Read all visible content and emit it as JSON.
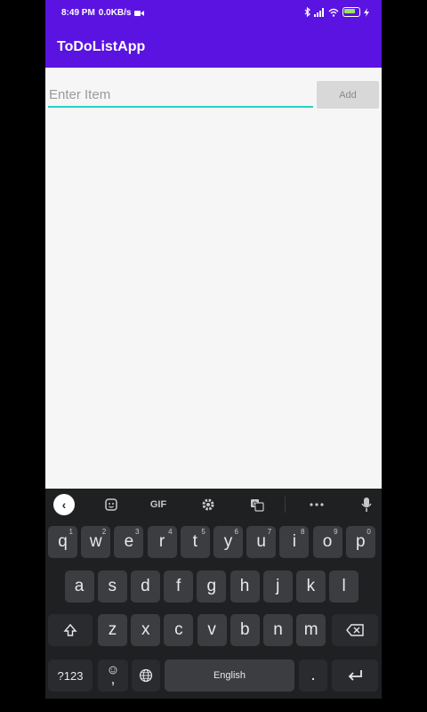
{
  "status": {
    "time": "8:49 PM",
    "net_speed": "0.0KB/s"
  },
  "app": {
    "title": "ToDoListApp"
  },
  "main": {
    "input_placeholder": "Enter Item",
    "input_value": "",
    "add_label": "Add"
  },
  "keyboard": {
    "toolbar": {
      "gif_label": "GIF"
    },
    "row1": [
      {
        "k": "q",
        "h": "1"
      },
      {
        "k": "w",
        "h": "2"
      },
      {
        "k": "e",
        "h": "3"
      },
      {
        "k": "r",
        "h": "4"
      },
      {
        "k": "t",
        "h": "5"
      },
      {
        "k": "y",
        "h": "6"
      },
      {
        "k": "u",
        "h": "7"
      },
      {
        "k": "i",
        "h": "8"
      },
      {
        "k": "o",
        "h": "9"
      },
      {
        "k": "p",
        "h": "0"
      }
    ],
    "row2": [
      "a",
      "s",
      "d",
      "f",
      "g",
      "h",
      "j",
      "k",
      "l"
    ],
    "row3": [
      "z",
      "x",
      "c",
      "v",
      "b",
      "n",
      "m"
    ],
    "symbols_label": "?123",
    "emoji_comma": ",",
    "space_label": "English",
    "period_label": "."
  }
}
